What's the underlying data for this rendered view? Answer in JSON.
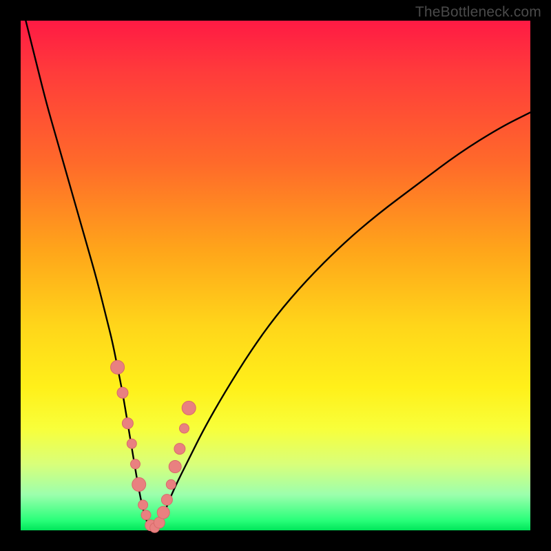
{
  "watermark": "TheBottleneck.com",
  "colors": {
    "background": "#000000",
    "gradient_top": "#ff1a44",
    "gradient_bottom": "#00e65a",
    "curve": "#000000",
    "dots": "#e98080"
  },
  "chart_data": {
    "type": "line",
    "title": "",
    "subtitle": "",
    "xlabel": "",
    "ylabel": "",
    "xlim": [
      0,
      100
    ],
    "ylim": [
      0,
      100
    ],
    "grid": false,
    "legend": false,
    "annotations": [],
    "series": [
      {
        "name": "bottleneck-curve",
        "x": [
          1,
          3,
          5,
          7,
          9,
          11,
          13,
          15,
          17,
          18,
          19,
          20,
          21,
          22,
          23,
          24,
          25,
          26,
          27,
          28,
          30,
          33,
          36,
          40,
          45,
          50,
          56,
          63,
          70,
          78,
          86,
          94,
          100
        ],
        "values": [
          100,
          92,
          84,
          77,
          70,
          63,
          56,
          49,
          41,
          37,
          32,
          27,
          21,
          15,
          9,
          4,
          1,
          0,
          1,
          3,
          8,
          14,
          20,
          27,
          35,
          42,
          49,
          56,
          62,
          68,
          74,
          79,
          82
        ]
      }
    ],
    "markers": {
      "name": "highlight-dots",
      "x": [
        19.0,
        20.0,
        21.0,
        21.8,
        22.5,
        23.2,
        24.0,
        24.6,
        25.5,
        26.3,
        27.2,
        28.0,
        28.7,
        29.5,
        30.3,
        31.2,
        32.1,
        33.0
      ],
      "values": [
        32.0,
        27.0,
        21.0,
        17.0,
        13.0,
        9.0,
        5.0,
        3.0,
        1.0,
        0.5,
        1.5,
        3.5,
        6.0,
        9.0,
        12.5,
        16.0,
        20.0,
        24.0
      ],
      "r": [
        10,
        8,
        8,
        7,
        7,
        10,
        7,
        7,
        8,
        7,
        8,
        9,
        8,
        7,
        9,
        8,
        7,
        10
      ]
    }
  }
}
